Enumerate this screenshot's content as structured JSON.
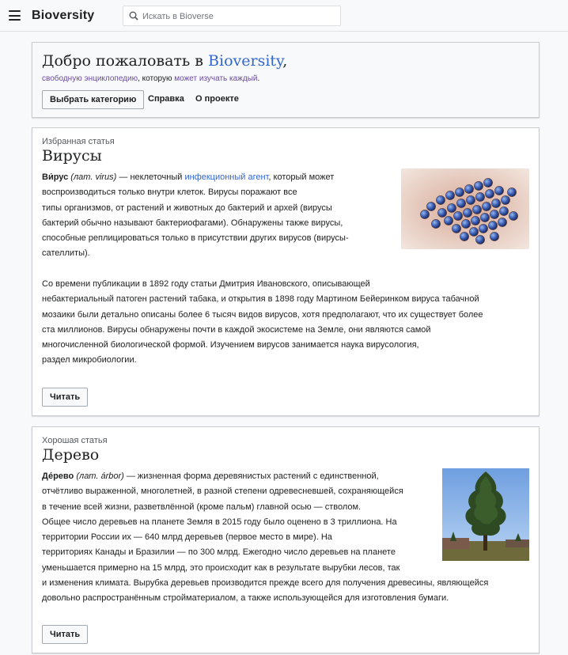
{
  "app": {
    "brand": "Bioversity"
  },
  "search": {
    "placeholder": "Искать в Bioverse"
  },
  "welcome": {
    "title_prefix": "Добро пожаловать в ",
    "title_link": "Bioversity",
    "title_suffix": ",",
    "sub_link1": "свободную энциклопедию",
    "sub_mid": ", которую ",
    "sub_link2": "может изучать каждый",
    "sub_end": ".",
    "button_category": "Выбрать категорию",
    "link_help": "Справка",
    "link_about": "О проекте"
  },
  "articles": [
    {
      "kicker": "Избранная статья",
      "title": "Вирусы",
      "p1_bold": "Ви́рус",
      "p1_italic": " (лат. virus)",
      "p1_a": " — неклеточный ",
      "p1_link": "инфекционный агент",
      "p1_lines": [
        ", который может",
        "воспроизводиться только внутри клеток. Вирусы поражают все",
        "типы организмов, от растений и животных до бактерий и архей (вирусы",
        "бактерий обычно называют бактериофагами). Обнаружены также вирусы,",
        "способные реплицироваться только в присутствии других вирусов (вирусы-",
        "сателлиты)."
      ],
      "p2_lines": [
        "Со времени публикации в 1892 году статьи Дмитрия Ивановского, описывающей",
        "небактериальный патоген растений табака, и открытия в 1898 году Мартином Бейеринком вируса табачной",
        "мозаики были детально описаны более 6 тысяч видов вирусов, хотя предполагают, что их существует более",
        "ста миллионов. Вирусы обнаружены почти в каждой экосистеме на Земле, они являются самой",
        "многочисленной биологической формой. Изучением вирусов занимается наука вирусология,",
        "раздел микробиологии."
      ],
      "read_label": "Читать",
      "image_icon": "virus-micrograph"
    },
    {
      "kicker": "Хорошая статья",
      "title": "Дерево",
      "p1_bold": "Де́рево",
      "p1_italic": " (лат. árbor)",
      "p1_lines": [
        " — жизненная форма деревянистых растений с единственной,",
        "отчётливо выраженной, многолетней, в разной степени одревесневшей, сохраняющейся",
        "в течение всей жизни, разветвлённой (кроме пальм) главной осью — стволом.",
        "Общее число деревьев на планете Земля в 2015 году было оценено в 3 триллиона. На",
        "территории России их — 640 млрд деревьев (первое место в мире). На",
        "территориях Канады и Бразилии — по 300 млрд. Ежегодно число деревьев на планете",
        "уменьшается примерно на 15 млрд, это происходит как в результате вырубки лесов, так",
        "и изменения климата. Вырубка деревьев производится прежде всего для получения древесины, являющейся",
        "довольно распространённым стройматериалом, а также использующейся для изготовления бумаги."
      ],
      "read_label": "Читать",
      "image_icon": "tree-photo"
    }
  ]
}
